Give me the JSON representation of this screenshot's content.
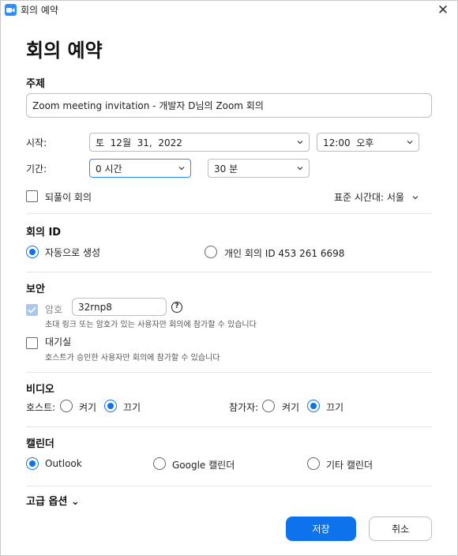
{
  "window": {
    "title": "회의 예약",
    "close_glyph": "✕",
    "icon": "zoom-camera-icon"
  },
  "heading": "회의 예약",
  "topic": {
    "label": "주제",
    "value": "Zoom meeting invitation - 개발자 D님의 Zoom 회의"
  },
  "start": {
    "label": "시작:",
    "date": "토  12월  31,  2022",
    "time": "12:00  오후"
  },
  "duration": {
    "label": "기간:",
    "hours": "0 시간",
    "minutes": "30 분"
  },
  "recurring": {
    "label": "되풀이 회의",
    "checked": false
  },
  "timezone": {
    "label": "표준 시간대: 서울"
  },
  "meeting_id": {
    "label": "회의 ID",
    "option_auto": "자동으로 생성",
    "option_personal": "개인 회의 ID 453 261 6698",
    "selected": "auto"
  },
  "security": {
    "label": "보안",
    "passcode_label": "암호",
    "passcode_value": "32rnp8",
    "passcode_help": "?",
    "passcode_hint": "초대 링크 또는 암호가 있는 사용자만 회의에 참가할 수 있습니다",
    "waiting_room_label": "대기실",
    "waiting_room_hint": "호스트가 승인한 사용자만 회의에 참가할 수 있습니다"
  },
  "video": {
    "label": "비디오",
    "host_label": "호스트:",
    "participant_label": "참가자:",
    "on": "켜기",
    "off": "끄기",
    "host_selected": "off",
    "participant_selected": "off"
  },
  "calendar": {
    "label": "캘린더",
    "outlook": "Outlook",
    "google": "Google 캘린더",
    "other": "기타 캘린더",
    "selected": "outlook"
  },
  "advanced": {
    "label": "고급 옵션 ⌄"
  },
  "buttons": {
    "save": "저장",
    "cancel": "취소"
  },
  "colors": {
    "accent": "#0e72ed",
    "zoom_blue": "#2d8cff",
    "disabled_check": "#a9c8ef"
  }
}
